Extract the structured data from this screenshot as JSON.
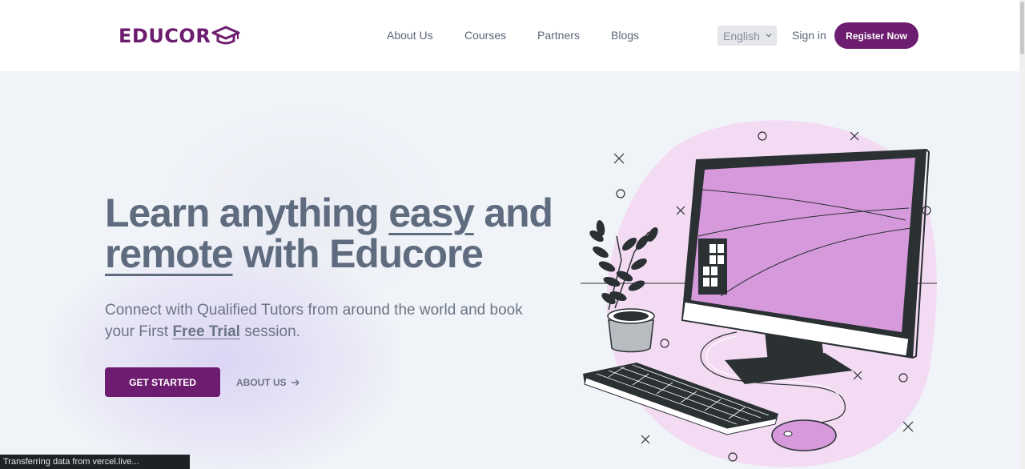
{
  "brand": {
    "logo_text": "EDUCOR",
    "color": "#6d1d6f"
  },
  "nav": {
    "links": [
      "About Us",
      "Courses",
      "Partners",
      "Blogs"
    ],
    "language": "English",
    "signin_label": "Sign in",
    "register_label": "Register Now"
  },
  "hero": {
    "line1_a": "Learn anything ",
    "line1_easy": "easy",
    "line1_b": " and",
    "line2_remote": "remote",
    "line2_b": " with Educore",
    "sub_a": "Connect with Qualified Tutors from around the world and book",
    "sub_b": "your First ",
    "sub_free": "Free Trial",
    "sub_c": " session.",
    "cta_label": "GET STARTED",
    "about_label": "ABOUT US"
  },
  "illustration": {
    "icon": "desktop-computer-plant-illustration"
  },
  "status": {
    "text": "Transferring data from vercel.live..."
  }
}
